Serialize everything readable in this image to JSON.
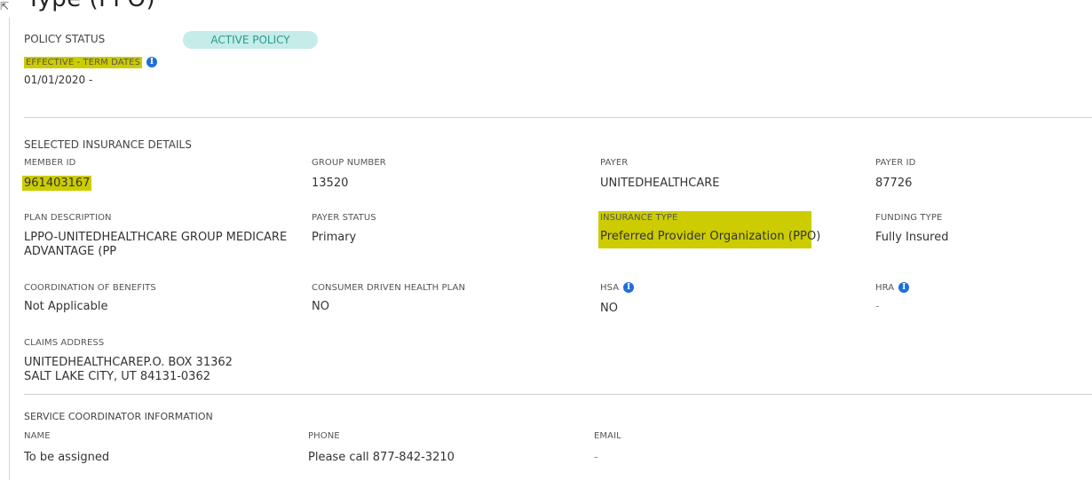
{
  "header_fragment": "Type (PPO)",
  "policy": {
    "status_label": "POLICY STATUS",
    "status_badge": "ACTIVE POLICY",
    "effective_label": "EFFECTIVE - TERM DATES",
    "effective_value": "01/01/2020 -"
  },
  "insurance": {
    "section_title": "SELECTED INSURANCE DETAILS",
    "member_id_label": "MEMBER ID",
    "member_id": "961403167",
    "group_number_label": "GROUP NUMBER",
    "group_number": "13520",
    "payer_label": "PAYER",
    "payer": "UNITEDHEALTHCARE",
    "payer_id_label": "PAYER ID",
    "payer_id": "87726",
    "plan_description_label": "PLAN DESCRIPTION",
    "plan_description_line1": "LPPO-UNITEDHEALTHCARE GROUP MEDICARE",
    "plan_description_line2": "ADVANTAGE (PP",
    "payer_status_label": "PAYER STATUS",
    "payer_status": "Primary",
    "insurance_type_label": "INSURANCE TYPE",
    "insurance_type": "Preferred Provider Organization (PPO)",
    "funding_type_label": "FUNDING TYPE",
    "funding_type": "Fully Insured",
    "cob_label": "COORDINATION OF BENEFITS",
    "cob": "Not Applicable",
    "cdhp_label": "CONSUMER DRIVEN HEALTH PLAN",
    "cdhp": "NO",
    "hsa_label": "HSA",
    "hsa": "NO",
    "hra_label": "HRA",
    "hra": "-",
    "claims_address_label": "CLAIMS ADDRESS",
    "claims_address_line1": "UNITEDHEALTHCAREP.O. BOX 31362",
    "claims_address_line2": "SALT LAKE CITY, UT 84131-0362"
  },
  "coordinator": {
    "section_title": "SERVICE COORDINATOR INFORMATION",
    "name_label": "NAME",
    "name": "To be assigned",
    "phone_label": "PHONE",
    "phone": "Please call 877-842-3210",
    "email_label": "EMAIL",
    "email": "-"
  },
  "colors": {
    "highlight": "#cccc00",
    "badge_bg": "#c5ece8",
    "badge_text": "#2a9a8a",
    "info_icon": "#1f6fd6"
  }
}
